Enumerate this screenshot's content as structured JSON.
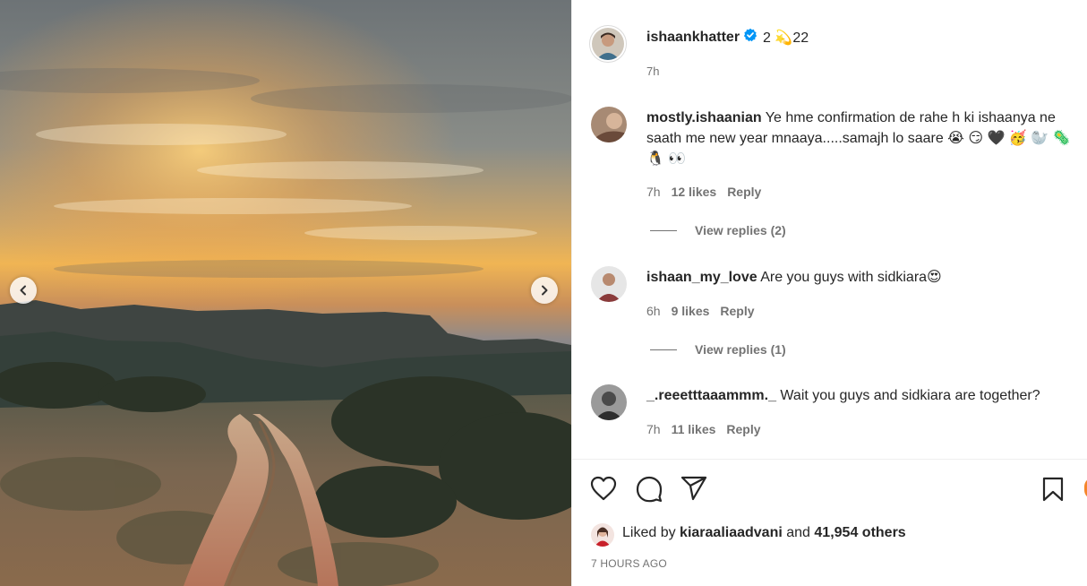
{
  "post": {
    "author": "ishaankhatter",
    "verified": true,
    "caption": "2 💫22",
    "time": "7h",
    "liked_prefix": "Liked by",
    "liked_user": "kiaraaliaadvani",
    "liked_and": "and",
    "liked_others": "41,954 others",
    "post_time": "7 HOURS AGO"
  },
  "comments": [
    {
      "username": "mostly.ishaanian",
      "text": "Ye hme confirmation de rahe h ki ishaanya ne saath me new year mnaaya.....samajh lo saare",
      "emojis_trailing": "😭 😏 🖤 🥳 🦭 🦠 🐧 👀",
      "time": "7h",
      "likes": "12 likes",
      "reply": "Reply",
      "view_replies": "View replies (2)"
    },
    {
      "username": "ishaan_my_love",
      "text": "Are you guys with sidkiara",
      "emojis_trailing": "😍",
      "time": "6h",
      "likes": "9 likes",
      "reply": "Reply",
      "view_replies": "View replies (1)"
    },
    {
      "username": "_.reeetttaaammm._",
      "text": "Wait you guys and sidkiara are together?",
      "time": "7h",
      "likes": "11 likes",
      "reply": "Reply"
    }
  ],
  "icons": {
    "like": "heart-icon",
    "comment": "comment-icon",
    "share": "share-icon",
    "save": "bookmark-icon",
    "prev": "chevron-left-icon",
    "next": "chevron-right-icon",
    "verified": "verified-badge-icon"
  },
  "colors": {
    "text": "#262626",
    "secondary": "#737373",
    "verified_blue": "#0095f6",
    "divider": "#efefef"
  }
}
